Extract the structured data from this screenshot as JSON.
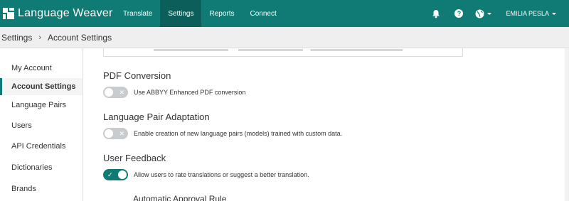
{
  "app": {
    "title": "Language Weaver"
  },
  "nav": {
    "items": [
      {
        "label": "Translate",
        "active": false
      },
      {
        "label": "Settings",
        "active": true
      },
      {
        "label": "Reports",
        "active": false
      },
      {
        "label": "Connect",
        "active": false
      }
    ],
    "icons": [
      "bell-icon",
      "help-icon",
      "globe-icon"
    ],
    "help_glyph": "?",
    "user_name": "EMILIA PESLA"
  },
  "breadcrumb": {
    "items": [
      "Settings",
      "Account Settings"
    ],
    "separator": "›"
  },
  "sidebar": {
    "items": [
      {
        "label": "My Account",
        "active": false
      },
      {
        "label": "Account Settings",
        "active": true
      },
      {
        "label": "Language Pairs",
        "active": false
      },
      {
        "label": "Users",
        "active": false
      },
      {
        "label": "API Credentials",
        "active": false
      },
      {
        "label": "Dictionaries",
        "active": false
      },
      {
        "label": "Brands",
        "active": false
      }
    ]
  },
  "main": {
    "pdf": {
      "title": "PDF Conversion",
      "toggle_label": "Use ABBYY Enhanced PDF conversion",
      "enabled": false
    },
    "adaptation": {
      "title": "Language Pair Adaptation",
      "toggle_label": "Enable creation of new language pairs (models) trained with custom data.",
      "enabled": false
    },
    "feedback": {
      "title": "User Feedback",
      "toggle_label": "Allow users to rate translations or suggest a better translation.",
      "enabled": true
    },
    "approval": {
      "title": "Automatic Approval Rule"
    }
  },
  "colors": {
    "brand": "#0f7b74",
    "brand_dark": "#0b5e59",
    "toggle_off": "#c9cccf"
  }
}
